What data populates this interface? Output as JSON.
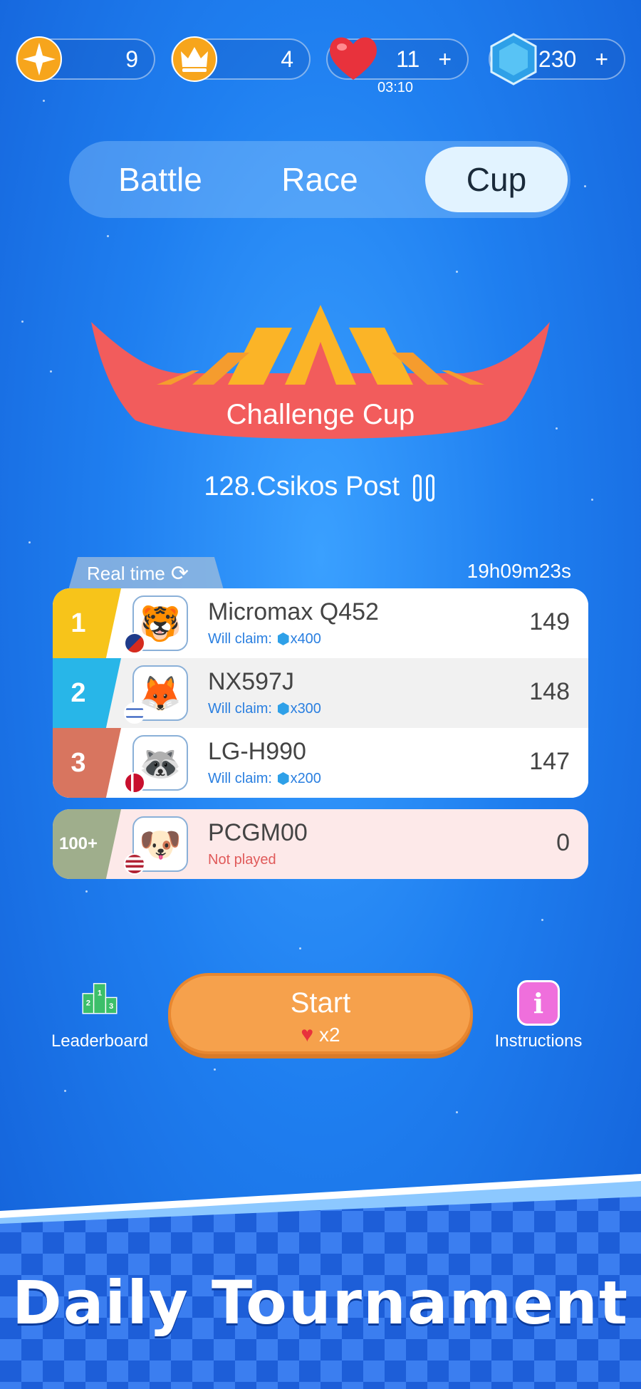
{
  "top_bar": {
    "stars": {
      "value": "9",
      "icon": "star-icon"
    },
    "crowns": {
      "value": "4",
      "icon": "crown-icon"
    },
    "lives": {
      "value": "11",
      "plus": "+",
      "timer": "03:10",
      "icon": "heart-icon"
    },
    "gems": {
      "value": "230",
      "plus": "+",
      "icon": "gem-icon"
    }
  },
  "tabs": [
    {
      "label": "Battle",
      "active": false
    },
    {
      "label": "Race",
      "active": false
    },
    {
      "label": "Cup",
      "active": true
    }
  ],
  "cup": {
    "title": "Challenge Cup",
    "puzzle": "128.Csikos Post"
  },
  "leaderboard": {
    "mode_label": "Real time",
    "countdown": "19h09m23s",
    "rows": [
      {
        "rank": "1",
        "name": "Micromax Q452",
        "claim_label": "Will claim:",
        "claim_amount": "x400",
        "score": "149",
        "avatar": "tiger-avatar",
        "flag": "flag-icon"
      },
      {
        "rank": "2",
        "name": "NX597J",
        "claim_label": "Will claim:",
        "claim_amount": "x300",
        "score": "148",
        "avatar": "fox-avatar",
        "flag": "flag-israel-icon"
      },
      {
        "rank": "3",
        "name": "LG-H990",
        "claim_label": "Will claim:",
        "claim_amount": "x200",
        "score": "147",
        "avatar": "raccoon-avatar",
        "flag": "flag-denmark-icon"
      }
    ],
    "me": {
      "rank": "100+",
      "name": "PCGM00",
      "status": "Not played",
      "score": "0",
      "avatar": "dog-avatar",
      "flag": "flag-usa-icon"
    }
  },
  "controls": {
    "leaderboard_label": "Leaderboard",
    "start_label": "Start",
    "start_cost": "x2",
    "instructions_label": "Instructions",
    "instructions_glyph": "i"
  },
  "footer": {
    "title": "Daily Tournament"
  },
  "colors": {
    "background": "#1f7ff0",
    "start_button": "#f6a14c",
    "gold": "#f7c41a",
    "silver": "#28b6e8",
    "bronze": "#d8755f",
    "my_row": "#fde9e9",
    "instructions": "#ef6fdc"
  }
}
